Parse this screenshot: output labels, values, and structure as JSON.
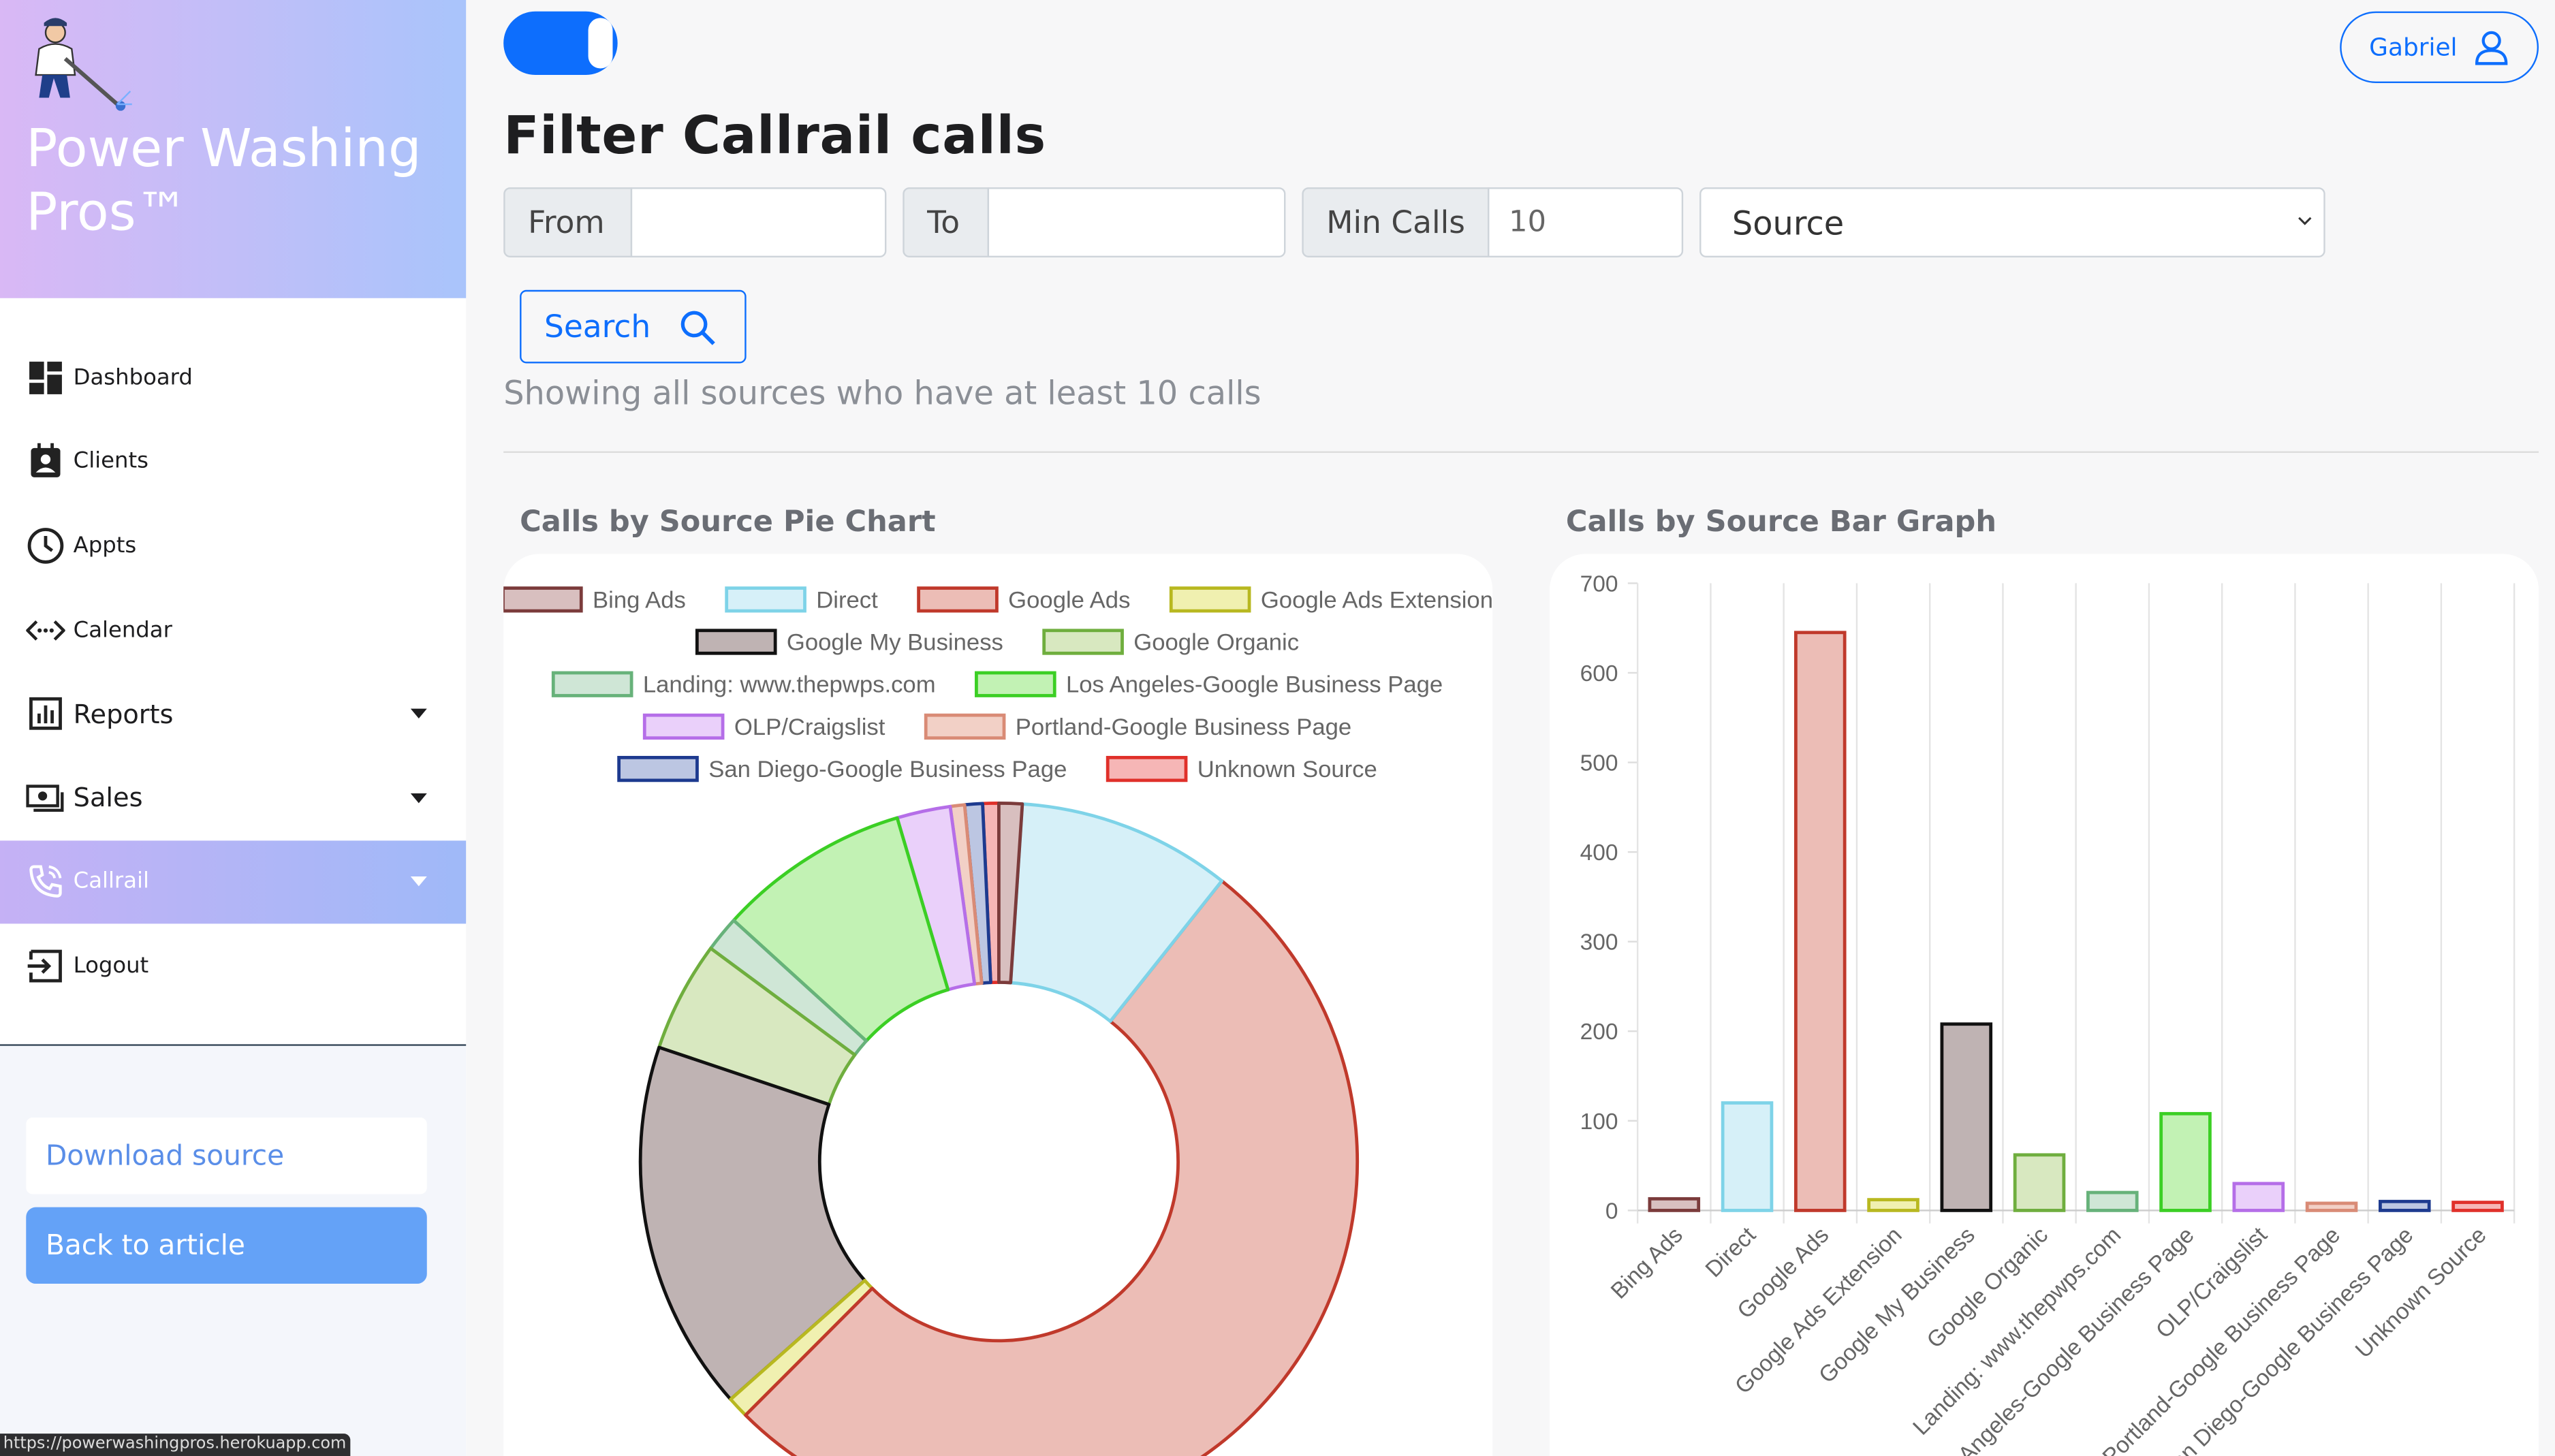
{
  "app": {
    "brand_title": "Power Washing Pros™",
    "status_url": "https://powerwashingpros.herokuapp.com"
  },
  "sidebar": {
    "items": [
      {
        "label": "Dashboard",
        "icon": "dashboard-icon"
      },
      {
        "label": "Clients",
        "icon": "contact-card-icon"
      },
      {
        "label": "Appts",
        "icon": "clock-icon"
      },
      {
        "label": "Calendar",
        "icon": "code-arrows-icon"
      },
      {
        "label": "Reports",
        "icon": "bar-chart-icon",
        "expandable": true
      },
      {
        "label": "Sales",
        "icon": "cash-icon",
        "expandable": true
      },
      {
        "label": "Callrail",
        "icon": "phone-icon",
        "expandable": true,
        "active": true
      },
      {
        "label": "Logout",
        "icon": "logout-icon"
      }
    ],
    "download_label": "Download source",
    "back_label": "Back to article"
  },
  "header": {
    "user_name": "Gabriel",
    "toggle_on": true
  },
  "filter": {
    "title": "Filter Callrail calls",
    "from_label": "From",
    "from_value": "",
    "to_label": "To",
    "to_value": "",
    "min_calls_label": "Min Calls",
    "min_calls_value": "10",
    "source_selected": "Source",
    "search_label": "Search",
    "summary": "Showing all sources who have at least 10 calls"
  },
  "colors": {
    "accent": "#0d6efd",
    "sidebar_gradient_start": "#d9b8f5",
    "sidebar_gradient_end": "#a9c4fb"
  },
  "chart_data": [
    {
      "type": "pie",
      "title": "Calls by Source Pie Chart",
      "legend_position": "top",
      "categories": [
        "Bing Ads",
        "Direct",
        "Google Ads",
        "Google Ads Extension",
        "Google My Business",
        "Google Organic",
        "Landing: www.thepwps.com",
        "Los Angeles-Google Business Page",
        "OLP/Craigslist",
        "Portland-Google Business Page",
        "San Diego-Google Business Page",
        "Unknown Source"
      ],
      "values": [
        13,
        120,
        645,
        12,
        208,
        62,
        20,
        108,
        30,
        8,
        10,
        9
      ],
      "colors": [
        {
          "fill": "#d8bfbf",
          "stroke": "#7b3b3b"
        },
        {
          "fill": "#d6f0f8",
          "stroke": "#7ed3e8"
        },
        {
          "fill": "#ecbdb6",
          "stroke": "#c0392b"
        },
        {
          "fill": "#f0f0b0",
          "stroke": "#b8b820"
        },
        {
          "fill": "#bfb3b3",
          "stroke": "#111111"
        },
        {
          "fill": "#d8e8c0",
          "stroke": "#6fae3e"
        },
        {
          "fill": "#cfe6d6",
          "stroke": "#67b27a"
        },
        {
          "fill": "#c2f2b4",
          "stroke": "#3bcf24"
        },
        {
          "fill": "#ead0fa",
          "stroke": "#b56ee8"
        },
        {
          "fill": "#f2d0c6",
          "stroke": "#d98b76"
        },
        {
          "fill": "#bcc6e2",
          "stroke": "#1d3a8f"
        },
        {
          "fill": "#f6b6b6",
          "stroke": "#e0302a"
        }
      ]
    },
    {
      "type": "bar",
      "title": "Calls by Source Bar Graph",
      "categories": [
        "Bing Ads",
        "Direct",
        "Google Ads",
        "Google Ads Extension",
        "Google My Business",
        "Google Organic",
        "Landing: www.thepwps.com",
        "Los Angeles-Google Business Page",
        "OLP/Craigslist",
        "Portland-Google Business Page",
        "San Diego-Google Business Page",
        "Unknown Source"
      ],
      "values": [
        13,
        120,
        645,
        12,
        208,
        62,
        20,
        108,
        30,
        8,
        10,
        9
      ],
      "ylim": [
        0,
        700
      ],
      "yticks": [
        0,
        100,
        200,
        300,
        400,
        500,
        600,
        700
      ],
      "grid": true
    }
  ]
}
